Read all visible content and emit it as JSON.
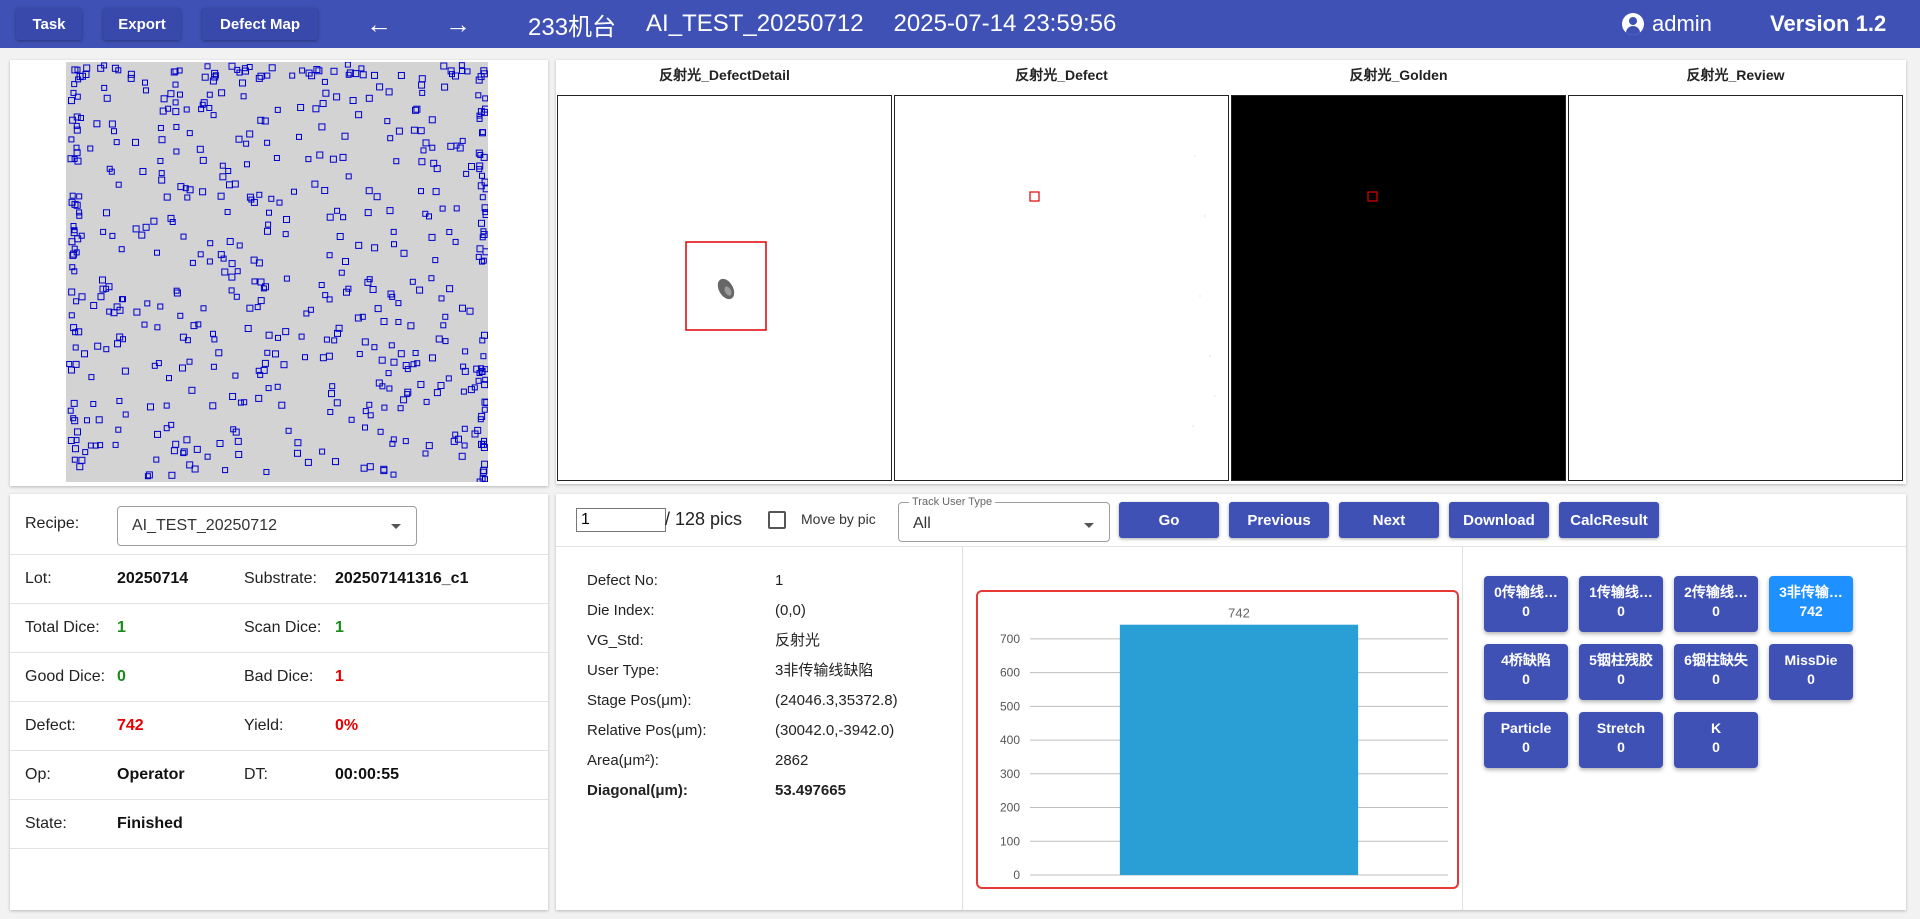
{
  "toolbar": {
    "task_label": "Task",
    "export_label": "Export",
    "defect_map_label": "Defect Map",
    "back_icon": "arrow-left-icon",
    "forward_icon": "arrow-right-icon"
  },
  "header": {
    "machine": "233机台",
    "recipe": "AI_TEST_20250712",
    "datetime": "2025-07-14 23:59:56",
    "user": "admin",
    "version": "Version 1.2"
  },
  "images": [
    {
      "label": "反射光_DefectDetail"
    },
    {
      "label": "反射光_Defect"
    },
    {
      "label": "反射光_Golden"
    },
    {
      "label": "反射光_Review"
    }
  ],
  "info": {
    "recipe_label": "Recipe:",
    "recipe_value": "AI_TEST_20250712",
    "lot_label": "Lot:",
    "lot_value": "20250714",
    "substrate_label": "Substrate:",
    "substrate_value": "202507141316_c1",
    "total_dice_label": "Total Dice:",
    "total_dice_value": "1",
    "scan_dice_label": "Scan Dice:",
    "scan_dice_value": "1",
    "good_dice_label": "Good Dice:",
    "good_dice_value": "0",
    "bad_dice_label": "Bad Dice:",
    "bad_dice_value": "1",
    "defect_label": "Defect:",
    "defect_value": "742",
    "yield_label": "Yield:",
    "yield_value": "0%",
    "op_label": "Op:",
    "op_value": "Operator",
    "dt_label": "DT:",
    "dt_value": "00:00:55",
    "state_label": "State:",
    "state_value": "Finished"
  },
  "controls": {
    "page_value": "1",
    "total_pics": "/ 128 pics",
    "move_by_pic_label": "Move by pic",
    "track_user_type_legend": "Track User Type",
    "track_user_type_value": "All",
    "go_label": "Go",
    "previous_label": "Previous",
    "next_label": "Next",
    "download_label": "Download",
    "calc_result_label": "CalcResult"
  },
  "defect_detail": [
    {
      "key": "Defect No:",
      "value": "1"
    },
    {
      "key": "Die Index:",
      "value": "(0,0)"
    },
    {
      "key": "VG_Std:",
      "value": "反射光"
    },
    {
      "key": "User Type:",
      "value": "3非传输线缺陷"
    },
    {
      "key": "Stage Pos(μm):",
      "value": "(24046.3,35372.8)"
    },
    {
      "key": "Relative Pos(μm):",
      "value": "(30042.0,-3942.0)"
    },
    {
      "key": "Area(μm²):",
      "value": "2862"
    },
    {
      "key": "Diagonal(μm):",
      "value": "53.497665"
    }
  ],
  "defect_types": [
    {
      "name": "0传输线…",
      "count": "0",
      "selected": false
    },
    {
      "name": "1传输线…",
      "count": "0",
      "selected": false
    },
    {
      "name": "2传输线…",
      "count": "0",
      "selected": false
    },
    {
      "name": "3非传输…",
      "count": "742",
      "selected": true
    },
    {
      "name": "4桥缺陷",
      "count": "0",
      "selected": false
    },
    {
      "name": "5铟柱残胶",
      "count": "0",
      "selected": false
    },
    {
      "name": "6铟柱缺失",
      "count": "0",
      "selected": false
    },
    {
      "name": "MissDie",
      "count": "0",
      "selected": false
    },
    {
      "name": "Particle",
      "count": "0",
      "selected": false
    },
    {
      "name": "Stretch",
      "count": "0",
      "selected": false
    },
    {
      "name": "K",
      "count": "0",
      "selected": false
    }
  ],
  "chart_data": {
    "type": "bar",
    "categories": [
      ""
    ],
    "values": [
      742
    ],
    "data_labels": [
      "742"
    ],
    "ylim": [
      0,
      750
    ],
    "yticks": [
      "0",
      "100",
      "200",
      "300",
      "400",
      "500",
      "600",
      "700"
    ],
    "bar_color": "#2a9fd6",
    "grid": true
  },
  "colors": {
    "header": "#3f51b5",
    "button": "#3f51b5",
    "selected_button": "#1e90ff",
    "good": "#1a8a1a",
    "bad": "#e60000",
    "map_marker": "#0000cc"
  }
}
